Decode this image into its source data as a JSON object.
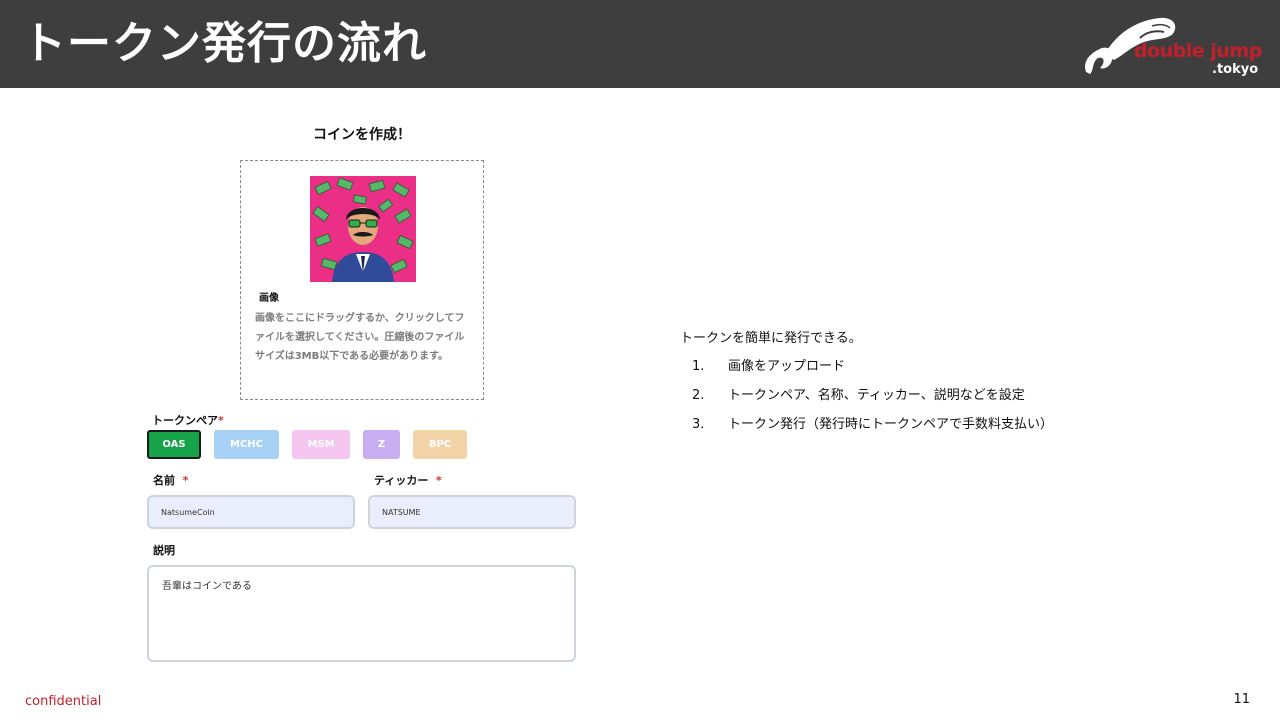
{
  "slide": {
    "title": "トークン発行の流れ",
    "logo_main": "double jump",
    "logo_sub": ".tokyo",
    "confidential": "confidential",
    "page_number": "11"
  },
  "form": {
    "title": "コインを作成！",
    "image_label": "画像",
    "image_help": "画像をここにドラッグするか、クリックしてファイルを選択してください。圧縮後のファイルサイズは3MB以下である必要があります。",
    "token_pair_label": "トークンペア",
    "required_mark": "*",
    "token_pairs": [
      {
        "label": "OAS",
        "color": "#16a34a",
        "selected": true
      },
      {
        "label": "MCHC",
        "color": "#a8d2f5",
        "selected": false
      },
      {
        "label": "MSM",
        "color": "#f5c6ef",
        "selected": false
      },
      {
        "label": "Z",
        "color": "#c8aef0",
        "selected": false
      },
      {
        "label": "BPC",
        "color": "#f3d3a8",
        "selected": false
      }
    ],
    "name_label": "名前",
    "name_value": "NatsumeCoin",
    "ticker_label": "ティッカー",
    "ticker_value": "NATSUME",
    "description_label": "説明",
    "description_value": "吾輩はコインである"
  },
  "description": {
    "intro": "トークンを簡単に発行できる。",
    "steps": [
      {
        "num": "1.",
        "text": "画像をアップロード"
      },
      {
        "num": "2.",
        "text": "トークンペア、名称、ティッカー、説明などを設定"
      },
      {
        "num": "3.",
        "text": "トークン発行（発行時にトークンペアで手数料支払い）"
      }
    ]
  },
  "colors": {
    "header_bg": "#3e3e3e",
    "brand_red": "#c41e2a",
    "coin_bg": "#ec2f86"
  }
}
